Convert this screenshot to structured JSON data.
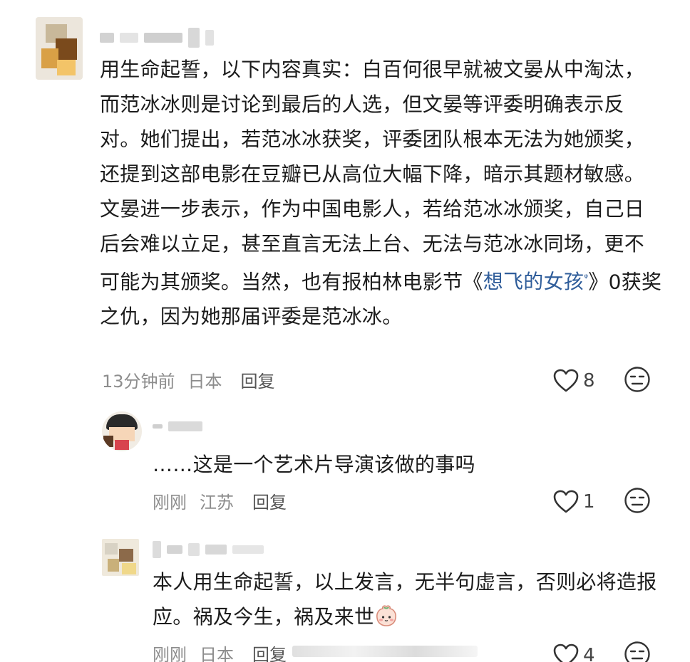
{
  "comments": [
    {
      "text_before_link": "用生命起誓，以下内容真实：白百何很早就被文晏从中淘汰，而范冰冰则是讨论到最后的人选，但文晏等评委明确表示反对。她们提出，若范冰冰获奖，评委团队根本无法为她颁奖，还提到这部电影在豆瓣已从高位大幅下降，暗示其题材敏感。文晏进一步表示，作为中国电影人，若给范冰冰颁奖，自己日后会难以立足，甚至直言无法上台、无法与范冰冰同场，更不可能为其颁奖。当然，也有报柏林电影节《",
      "link_text": "想飞的女孩",
      "link_glyph": "ᵠ",
      "text_after_link": "》0获奖之仇，因为她那届评委是范冰冰。",
      "time": "13分钟前",
      "location": "日本",
      "reply_label": "回复",
      "likes": "8"
    },
    {
      "text": "……这是一个艺术片导演该做的事吗",
      "time": "刚刚",
      "location": "江苏",
      "reply_label": "回复",
      "likes": "1"
    },
    {
      "text": "本人用生命起誓，以上发言，无半句虚言，否则必将造报应。祸及今生，祸及来世",
      "time": "刚刚",
      "location": "日本",
      "reply_label": "回复",
      "likes": "4"
    }
  ],
  "icons": {
    "like": "heart-outline-icon",
    "dislike": "neutral-face-icon",
    "emoji": "blushing-peach-emoji-icon"
  },
  "colors": {
    "link": "#2f5d9a",
    "meta": "#8d8d8d",
    "text": "#1c1c1c"
  }
}
